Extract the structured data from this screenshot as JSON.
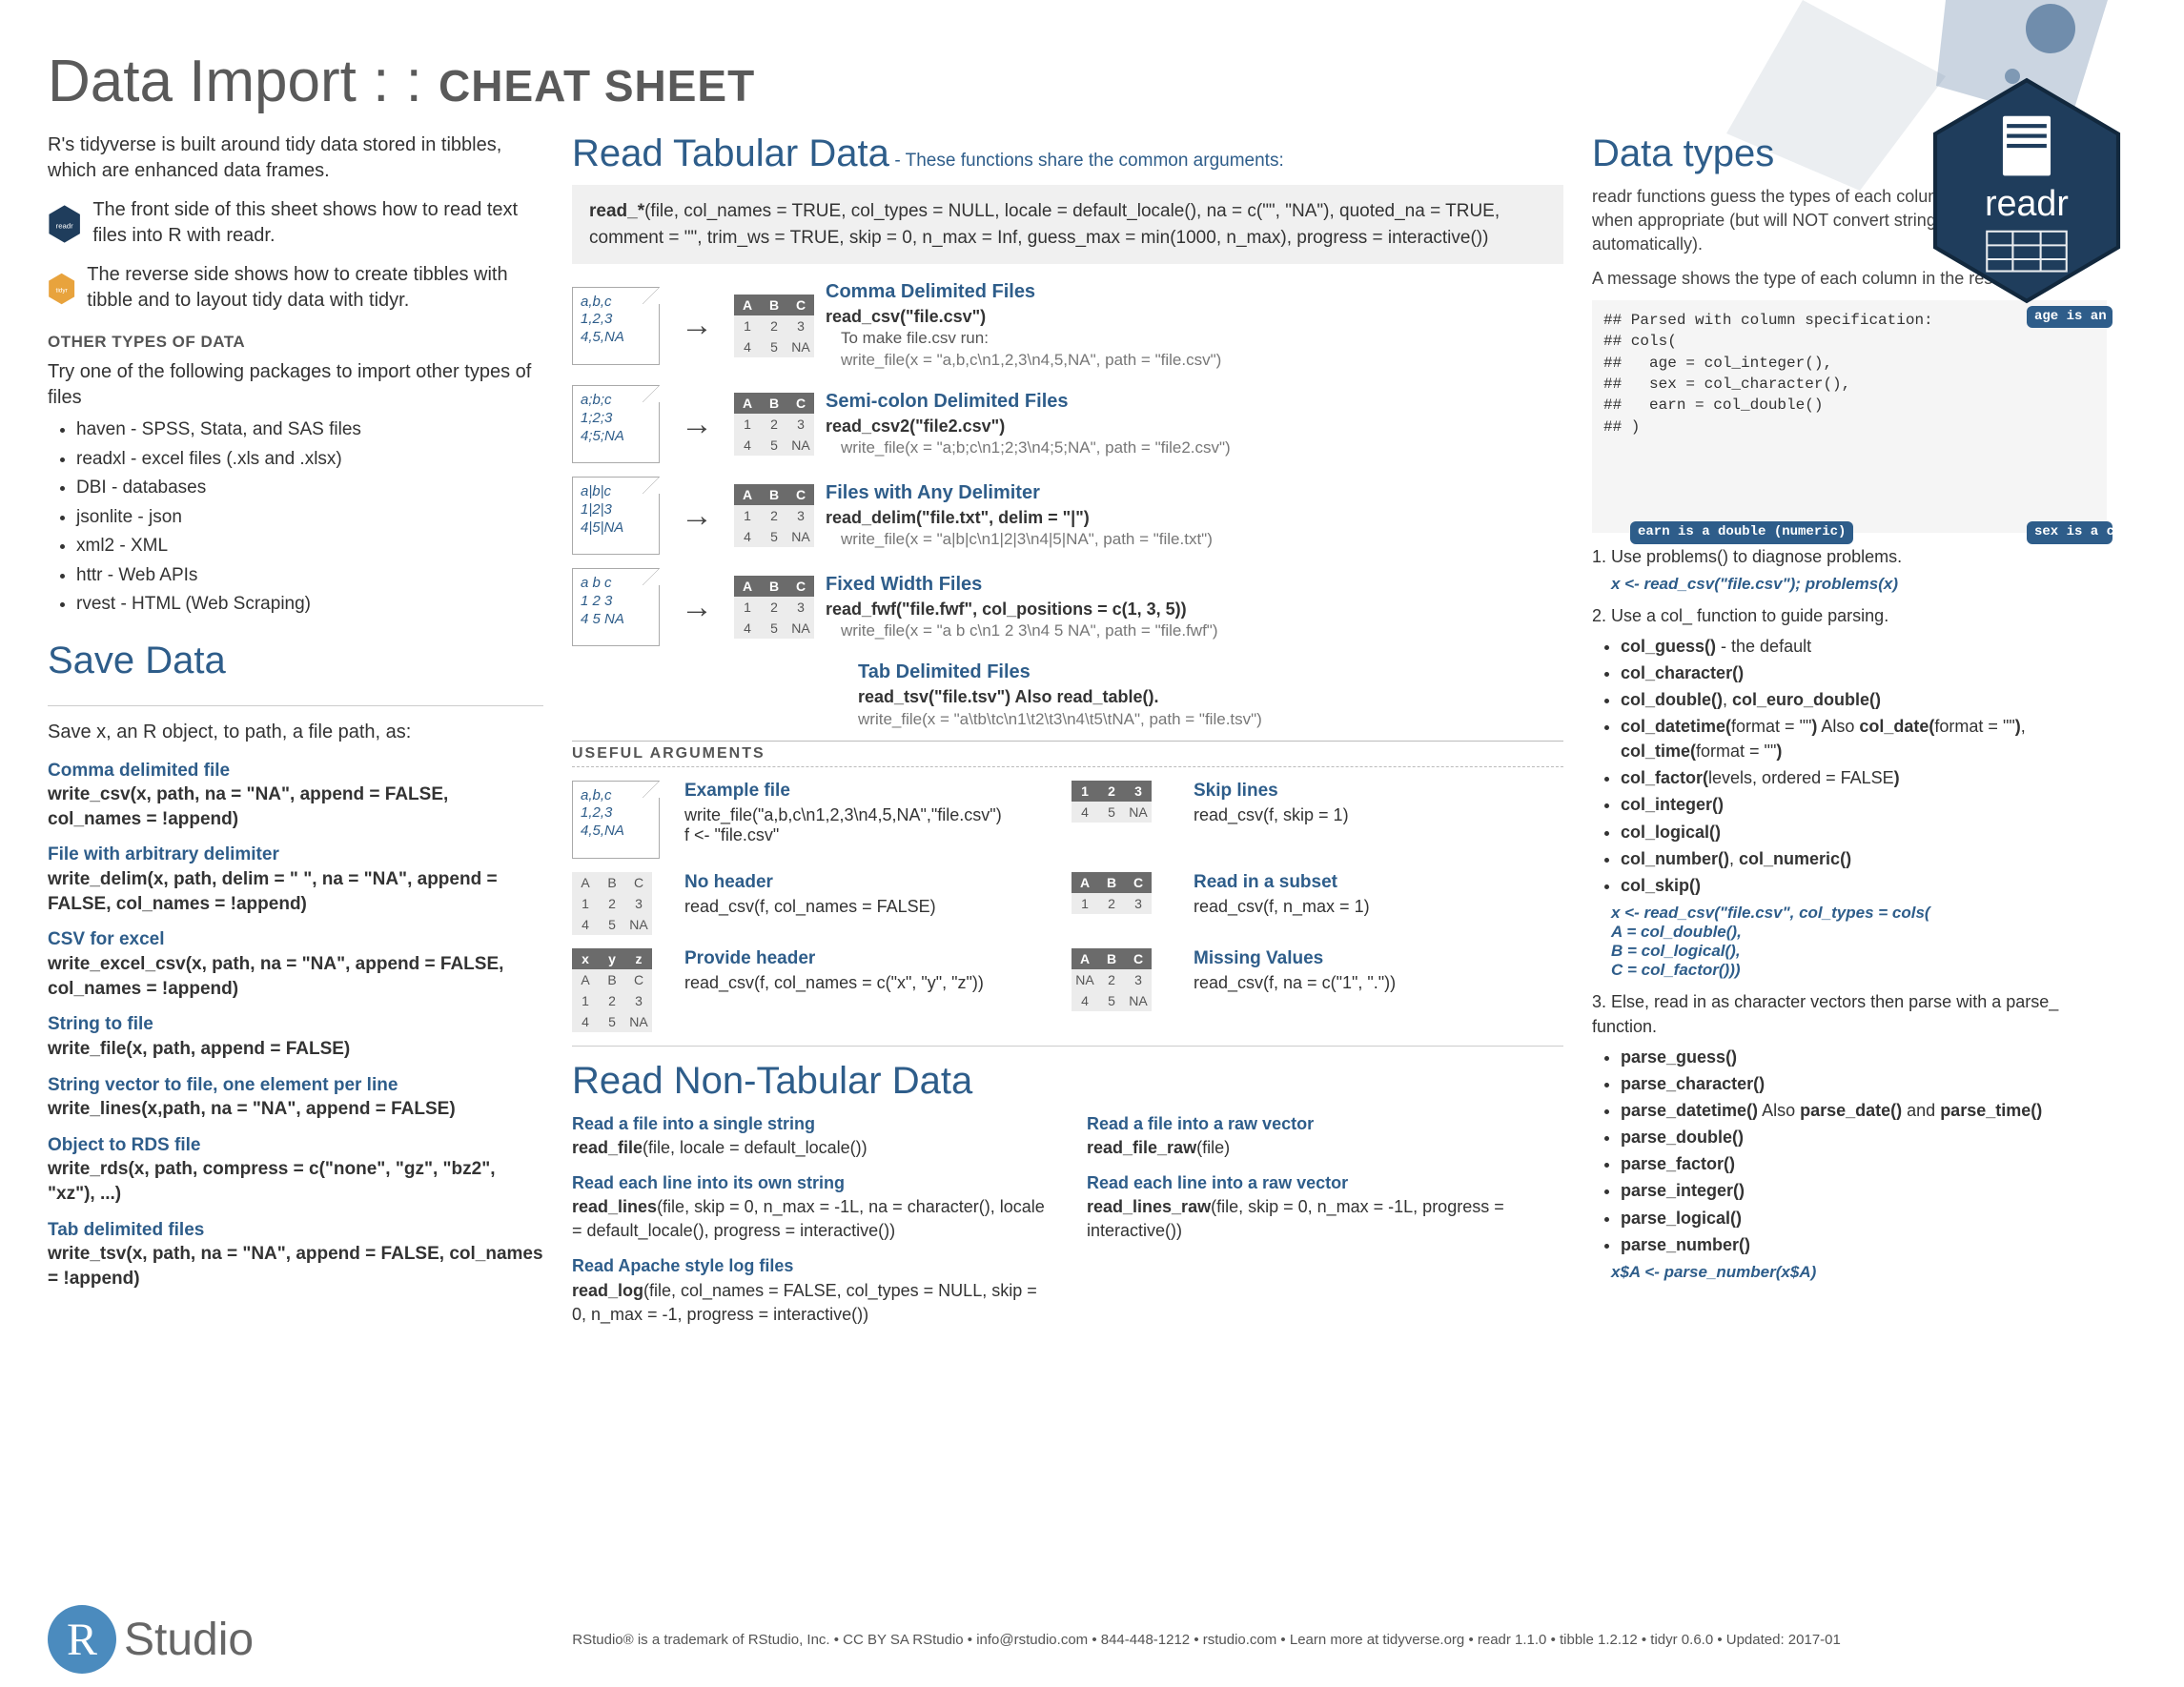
{
  "title_prefix": "Data Import : : ",
  "title_suffix": "CHEAT SHEET",
  "col1": {
    "intro": "R's tidyverse is built around tidy data stored in tibbles, which are enhanced data frames.",
    "front": "The front side of this sheet shows how to read text files into R with readr.",
    "reverse": "The reverse side shows how to create tibbles with tibble and to layout tidy data with tidyr.",
    "other_header": "OTHER TYPES OF DATA",
    "other_intro": "Try one of the following packages to import other types of files",
    "other_list": [
      "haven - SPSS, Stata, and SAS files",
      "readxl - excel files (.xls and .xlsx)",
      "DBI - databases",
      "jsonlite - json",
      "xml2 - XML",
      "httr - Web APIs",
      "rvest - HTML (Web Scraping)"
    ],
    "save_header": "Save Data",
    "save_intro": "Save x, an R object, to path, a file path, as:",
    "save": [
      {
        "t": "Comma delimited file",
        "c": "write_csv(x, path, na = \"NA\", append = FALSE, col_names = !append)"
      },
      {
        "t": "File with arbitrary delimiter",
        "c": "write_delim(x, path, delim = \" \", na = \"NA\", append = FALSE, col_names = !append)"
      },
      {
        "t": "CSV for excel",
        "c": "write_excel_csv(x, path, na = \"NA\", append = FALSE, col_names = !append)"
      },
      {
        "t": "String to file",
        "c": "write_file(x, path, append = FALSE)"
      },
      {
        "t": "String vector to file, one element per line",
        "c": "write_lines(x,path, na = \"NA\", append = FALSE)"
      },
      {
        "t": "Object to RDS file",
        "c": "write_rds(x, path, compress = c(\"none\", \"gz\", \"bz2\", \"xz\"), ...)"
      },
      {
        "t": "Tab delimited files",
        "c": "write_tsv(x, path, na = \"NA\", append = FALSE, col_names = !append)"
      }
    ]
  },
  "col2": {
    "rt_header": "Read Tabular Data",
    "rt_sub": " - These functions share the common arguments:",
    "sig": "read_*(file, col_names = TRUE, col_types = NULL, locale = default_locale(), na = c(\"\", \"NA\"), quoted_na = TRUE, comment = \"\", trim_ws = TRUE, skip = 0, n_max = Inf, guess_max = min(1000, n_max), progress = interactive())",
    "rows": [
      {
        "file": "a,b,c\n1,2,3\n4,5,NA",
        "title": "Comma Delimited Files",
        "fn": "read_csv(\"file.csv\")",
        "make": "To make file.csv run:",
        "wf": "write_file(x = \"a,b,c\\n1,2,3\\n4,5,NA\", path = \"file.csv\")"
      },
      {
        "file": "a;b;c\n1;2;3\n4;5;NA",
        "title": "Semi-colon Delimited Files",
        "fn": "read_csv2(\"file2.csv\")",
        "make": "",
        "wf": "write_file(x = \"a;b;c\\n1;2;3\\n4;5;NA\", path = \"file2.csv\")"
      },
      {
        "file": "a|b|c\n1|2|3\n4|5|NA",
        "title": "Files with Any Delimiter",
        "fn": "read_delim(\"file.txt\", delim = \"|\")",
        "make": "",
        "wf": "write_file(x = \"a|b|c\\n1|2|3\\n4|5|NA\", path = \"file.txt\")"
      },
      {
        "file": "a  b  c\n1  2  3\n4  5  NA",
        "title": "Fixed Width Files",
        "fn": "read_fwf(\"file.fwf\", col_positions = c(1, 3, 5))",
        "make": "",
        "wf": "write_file(x = \"a b c\\n1 2 3\\n4 5 NA\", path = \"file.fwf\")"
      }
    ],
    "tsv_title": "Tab Delimited Files",
    "tsv_fn": "read_tsv(\"file.tsv\") Also read_table().",
    "tsv_wf": "write_file(x = \"a\\tb\\tc\\n1\\t2\\t3\\n4\\t5\\tNA\", path = \"file.tsv\")",
    "ua_header": "USEFUL ARGUMENTS",
    "ua": {
      "ex_t": "Example file",
      "ex_c": "write_file(\"a,b,c\\n1,2,3\\n4,5,NA\",\"file.csv\")\nf <- \"file.csv\"",
      "skip_t": "Skip lines",
      "skip_c": "read_csv(f, skip = 1)",
      "nh_t": "No header",
      "nh_c": "read_csv(f, col_names = FALSE)",
      "sub_t": "Read in a subset",
      "sub_c": "read_csv(f, n_max = 1)",
      "ph_t": "Provide header",
      "ph_c": "read_csv(f, col_names = c(\"x\", \"y\", \"z\"))",
      "mv_t": "Missing Values",
      "mv_c": "read_csv(f, na = c(\"1\", \".\"))"
    },
    "nt_header": "Read Non-Tabular Data",
    "nt": {
      "f1t": "Read a file into a single string",
      "f1c": "read_file(file, locale = default_locale())",
      "f2t": "Read each line into its own string",
      "f2c": "read_lines(file, skip = 0, n_max = -1L, na = character(), locale = default_locale(), progress = interactive())",
      "f3t": "Read Apache style log files",
      "f3c": "read_log(file, col_names = FALSE, col_types = NULL, skip = 0, n_max = -1, progress = interactive())",
      "r1t": "Read a file into a raw vector",
      "r1c": "read_file_raw(file)",
      "r2t": "Read each line into a raw vector",
      "r2c": "read_lines_raw(file, skip = 0, n_max = -1L, progress = interactive())"
    }
  },
  "col3": {
    "dt_header": "Data types",
    "intro1": "readr functions guess the types of each column and convert types when appropriate (but will NOT convert strings to factors automatically).",
    "intro2": "A message shows the type of each column in the result.",
    "code": "## Parsed with column specification:\n## cols(\n##   age = col_integer(),\n##   sex = col_character(),\n##   earn = col_double()\n## )",
    "call1": "age is an integer",
    "call2": "sex is a character",
    "call3": "earn is a double (numeric)",
    "s1": "1. Use problems() to diagnose problems.",
    "s1c": "x <- read_csv(\"file.csv\"); problems(x)",
    "s2": "2. Use a col_ function to guide parsing.",
    "s2list": [
      "col_guess() - the default",
      "col_character()",
      "col_double(), col_euro_double()",
      "col_datetime(format = \"\") Also col_date(format = \"\"), col_time(format = \"\")",
      "col_factor(levels, ordered = FALSE)",
      "col_integer()",
      "col_logical()",
      "col_number(), col_numeric()",
      "col_skip()"
    ],
    "s2c": "x <- read_csv(\"file.csv\", col_types = cols(\n    A = col_double(),\n    B = col_logical(),\n    C = col_factor()))",
    "s3": "3. Else, read in as character vectors then parse with a parse_ function.",
    "s3list": [
      "parse_guess()",
      "parse_character()",
      "parse_datetime() Also parse_date() and parse_time()",
      "parse_double()",
      "parse_factor()",
      "parse_integer()",
      "parse_logical()",
      "parse_number()"
    ],
    "s3c": "x$A <- parse_number(x$A)"
  },
  "footer": "RStudio® is a trademark of RStudio, Inc.  •  CC BY SA  RStudio  •  info@rstudio.com  •  844-448-1212  •  rstudio.com  •  Learn more at tidyverse.org  •  readr  1.1.0  •  tibble  1.2.12  •  tidyr  0.6.0  •  Updated: 2017-01"
}
